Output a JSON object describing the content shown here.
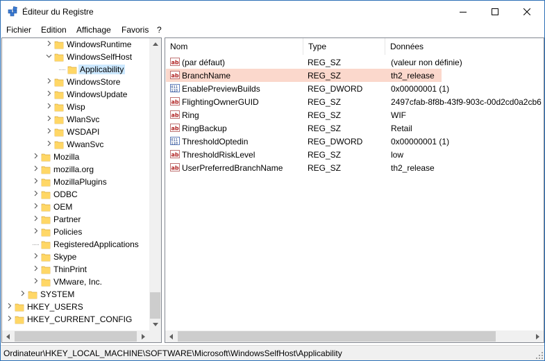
{
  "window": {
    "title": "Éditeur du Registre"
  },
  "menu": [
    "Fichier",
    "Edition",
    "Affichage",
    "Favoris",
    "?"
  ],
  "tree": [
    {
      "label": "WindowsRuntime",
      "level": 3,
      "expander": "right"
    },
    {
      "label": "WindowsSelfHost",
      "level": 3,
      "expander": "down"
    },
    {
      "label": "Applicability",
      "level": 4,
      "expander": "none",
      "selected": true
    },
    {
      "label": "WindowsStore",
      "level": 3,
      "expander": "right"
    },
    {
      "label": "WindowsUpdate",
      "level": 3,
      "expander": "right"
    },
    {
      "label": "Wisp",
      "level": 3,
      "expander": "right"
    },
    {
      "label": "WlanSvc",
      "level": 3,
      "expander": "right"
    },
    {
      "label": "WSDAPI",
      "level": 3,
      "expander": "right"
    },
    {
      "label": "WwanSvc",
      "level": 3,
      "expander": "right"
    },
    {
      "label": "Mozilla",
      "level": 2,
      "expander": "right"
    },
    {
      "label": "mozilla.org",
      "level": 2,
      "expander": "right"
    },
    {
      "label": "MozillaPlugins",
      "level": 2,
      "expander": "right"
    },
    {
      "label": "ODBC",
      "level": 2,
      "expander": "right"
    },
    {
      "label": "OEM",
      "level": 2,
      "expander": "right"
    },
    {
      "label": "Partner",
      "level": 2,
      "expander": "right"
    },
    {
      "label": "Policies",
      "level": 2,
      "expander": "right"
    },
    {
      "label": "RegisteredApplications",
      "level": 2,
      "expander": "none"
    },
    {
      "label": "Skype",
      "level": 2,
      "expander": "right"
    },
    {
      "label": "ThinPrint",
      "level": 2,
      "expander": "right"
    },
    {
      "label": "VMware, Inc.",
      "level": 2,
      "expander": "right"
    },
    {
      "label": "SYSTEM",
      "level": 1,
      "expander": "right"
    },
    {
      "label": "HKEY_USERS",
      "level": 0,
      "expander": "right"
    },
    {
      "label": "HKEY_CURRENT_CONFIG",
      "level": 0,
      "expander": "right"
    }
  ],
  "columns": {
    "name": "Nom",
    "type": "Type",
    "data": "Données"
  },
  "values": [
    {
      "icon": "string-value-icon",
      "name": "(par défaut)",
      "type": "REG_SZ",
      "data": "(valeur non définie)"
    },
    {
      "icon": "string-value-icon",
      "name": "BranchName",
      "type": "REG_SZ",
      "data": "th2_release",
      "highlight": true
    },
    {
      "icon": "dword-value-icon",
      "name": "EnablePreviewBuilds",
      "type": "REG_DWORD",
      "data": "0x00000001 (1)"
    },
    {
      "icon": "string-value-icon",
      "name": "FlightingOwnerGUID",
      "type": "REG_SZ",
      "data": "2497cfab-8f8b-43f9-903c-00d2cd0a2cb6"
    },
    {
      "icon": "string-value-icon",
      "name": "Ring",
      "type": "REG_SZ",
      "data": "WIF"
    },
    {
      "icon": "string-value-icon",
      "name": "RingBackup",
      "type": "REG_SZ",
      "data": "Retail"
    },
    {
      "icon": "dword-value-icon",
      "name": "ThresholdOptedin",
      "type": "REG_DWORD",
      "data": "0x00000001 (1)"
    },
    {
      "icon": "string-value-icon",
      "name": "ThresholdRiskLevel",
      "type": "REG_SZ",
      "data": "low"
    },
    {
      "icon": "string-value-icon",
      "name": "UserPreferredBranchName",
      "type": "REG_SZ",
      "data": "th2_release"
    }
  ],
  "status": {
    "path": "Ordinateur\\HKEY_LOCAL_MACHINE\\SOFTWARE\\Microsoft\\WindowsSelfHost\\Applicability"
  },
  "colors": {
    "selection": "#cce8ff",
    "highlight_row": "#fbd8cc",
    "folder": "#ffd766",
    "border": "#828790"
  }
}
